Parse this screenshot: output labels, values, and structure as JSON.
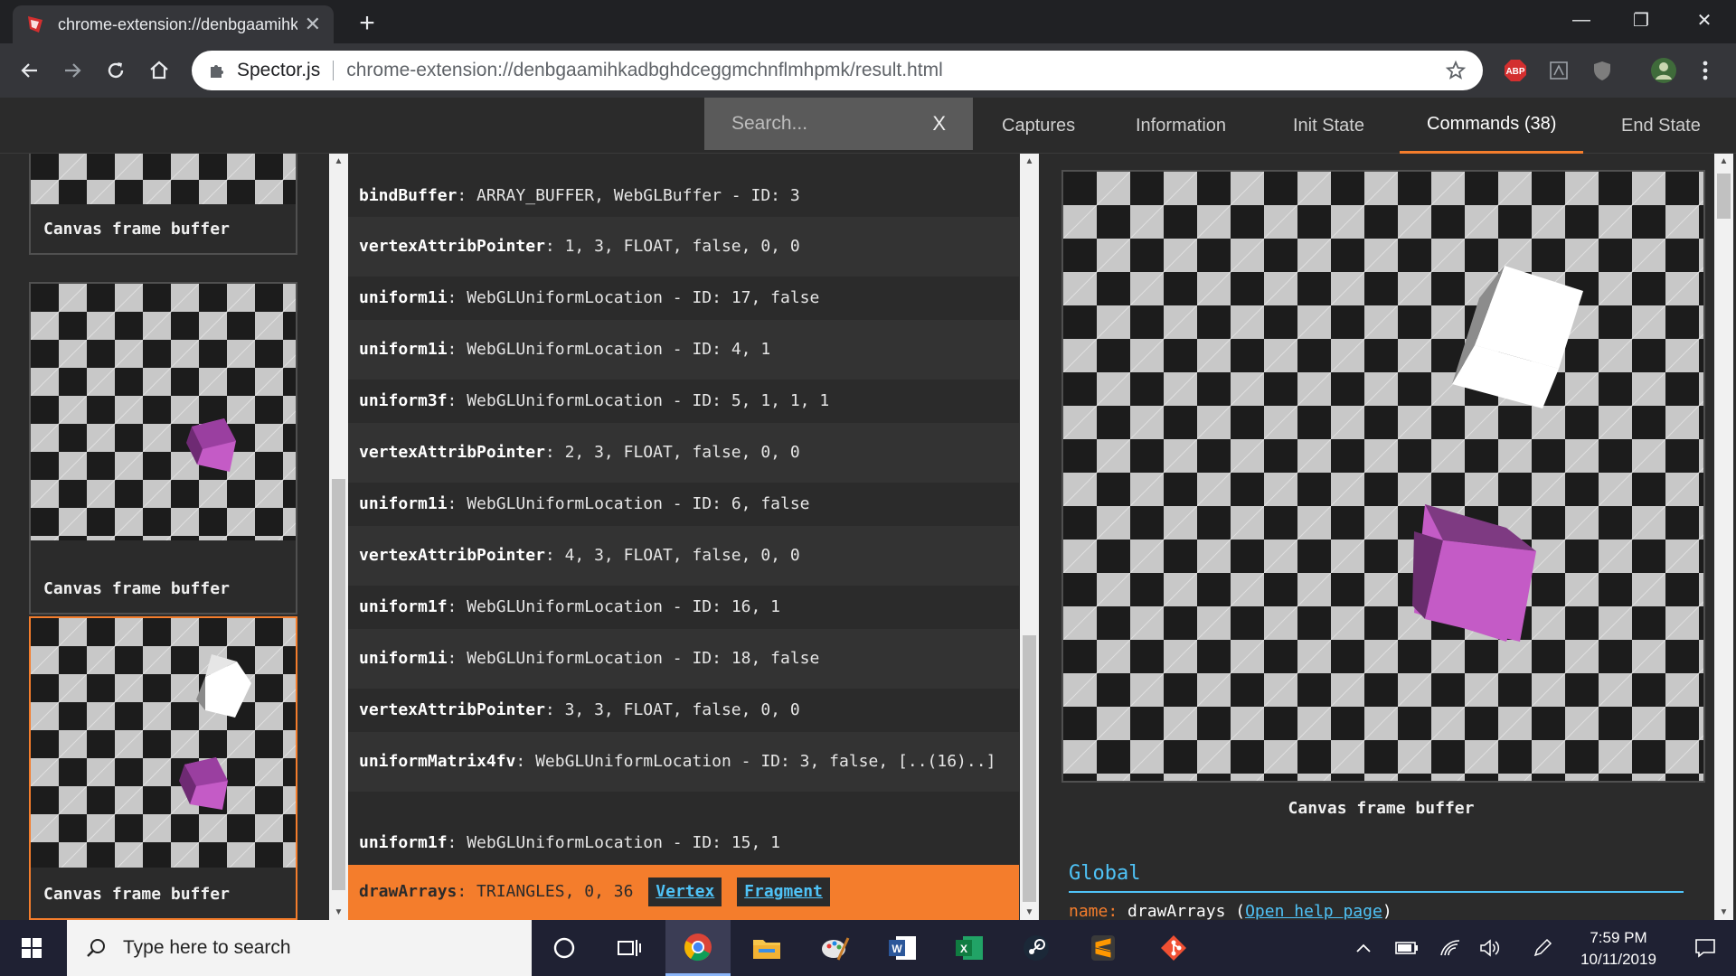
{
  "browser": {
    "tab_title": "chrome-extension://denbgaamihkadbghdceggmchnflmhpmk/result.html",
    "tab_close": "✕",
    "new_tab": "+",
    "site_name": "Spector.js",
    "url": "chrome-extension://denbgaamihkadbghdceggmchnflmhpmk/result.html",
    "extensions": [
      "ABP"
    ],
    "window_controls": [
      "—",
      "❐",
      "✕"
    ]
  },
  "spector": {
    "search_placeholder": "Search...",
    "search_clear": "X",
    "tabs": [
      {
        "label": "Captures",
        "active": false
      },
      {
        "label": "Information",
        "active": false
      },
      {
        "label": "Init State",
        "active": false
      },
      {
        "label": "Commands (38)",
        "active": true
      },
      {
        "label": "End State",
        "active": false
      }
    ],
    "captures": [
      {
        "label": "Canvas frame buffer",
        "selected": false
      },
      {
        "label": "Canvas frame buffer",
        "selected": false
      },
      {
        "label": "Canvas frame buffer",
        "selected": true
      }
    ],
    "commands": [
      {
        "fn": "bindBuffer",
        "args": ": ARRAY_BUFFER, WebGLBuffer - ID: 3"
      },
      {
        "fn": "vertexAttribPointer",
        "args": ": 1, 3, FLOAT, false, 0, 0"
      },
      {
        "fn": "uniform1i",
        "args": ": WebGLUniformLocation - ID: 17, false"
      },
      {
        "fn": "uniform1i",
        "args": ": WebGLUniformLocation - ID: 4, 1"
      },
      {
        "fn": "uniform3f",
        "args": ": WebGLUniformLocation - ID: 5, 1, 1, 1"
      },
      {
        "fn": "vertexAttribPointer",
        "args": ": 2, 3, FLOAT, false, 0, 0"
      },
      {
        "fn": "uniform1i",
        "args": ": WebGLUniformLocation - ID: 6, false"
      },
      {
        "fn": "vertexAttribPointer",
        "args": ": 4, 3, FLOAT, false, 0, 0"
      },
      {
        "fn": "uniform1f",
        "args": ": WebGLUniformLocation - ID: 16, 1"
      },
      {
        "fn": "uniform1i",
        "args": ": WebGLUniformLocation - ID: 18, false"
      },
      {
        "fn": "vertexAttribPointer",
        "args": ": 3, 3, FLOAT, false, 0, 0"
      },
      {
        "fn": "uniformMatrix4fv",
        "args": ": WebGLUniformLocation - ID: 3, false, [..(16)..]"
      },
      {
        "fn": "uniform1f",
        "args": ": WebGLUniformLocation - ID: 15, 1"
      }
    ],
    "active_command": {
      "fn": "drawArrays",
      "args": ": TRIANGLES, 0, 36",
      "vertex_label": "Vertex",
      "fragment_label": "Fragment"
    },
    "detail": {
      "canvas_label": "Canvas frame buffer",
      "global_title": "Global",
      "name_key": "name:",
      "name_value": "drawArrays",
      "help_open": "(",
      "help_link": "Open help page",
      "help_close": ")"
    },
    "colors": {
      "accent": "#f47d2c",
      "link": "#4fc3f7",
      "cube_purple": "#c45bc6"
    }
  },
  "taskbar": {
    "search_placeholder": "Type here to search",
    "time": "7:59 PM",
    "date": "10/11/2019",
    "apps": [
      "cortana-icon",
      "task-view-icon",
      "chrome-icon",
      "file-explorer-icon",
      "paint-icon",
      "word-icon",
      "excel-icon",
      "steam-icon",
      "sublime-icon",
      "git-icon"
    ]
  }
}
